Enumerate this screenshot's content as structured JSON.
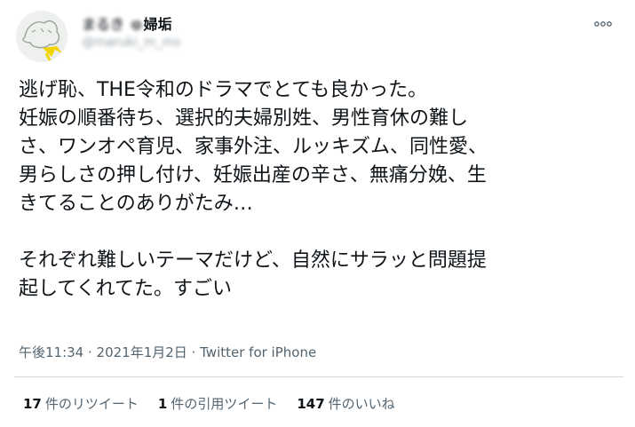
{
  "author": {
    "display_name_obscured": "まるき ゅ",
    "display_name_visible": "婦垢",
    "handle": "@maruki_m_ms",
    "avatar_icon": "avatar-illustration-icon"
  },
  "more_icon": "ellipsis-icon",
  "tweet": {
    "text": "逃げ恥、THE令和のドラマでとても良かった。\n妊娠の順番待ち、選択的夫婦別姓、男性育休の難し\nさ、ワンオペ育児、家事外注、ルッキズム、同性愛、\n男らしさの押し付け、妊娠出産の辛さ、無痛分娩、生\nきてることのありがたみ…\n\nそれぞれ難しいテーマだけど、自然にサラッと問題提\n起してくれてた。すごい",
    "time": "午後11:34",
    "separator": " · ",
    "date": "2021年1月2日",
    "source": "Twitter for iPhone"
  },
  "stats": {
    "retweets_count": "17",
    "retweets_label": "件のリツイート",
    "quotes_count": "1",
    "quotes_label": "件の引用ツイート",
    "likes_count": "147",
    "likes_label": "件のいいね"
  },
  "colors": {
    "text": "#0f1419",
    "secondary": "#536471",
    "divider": "#cfd9de",
    "avatar_accent": "#f2d400"
  }
}
